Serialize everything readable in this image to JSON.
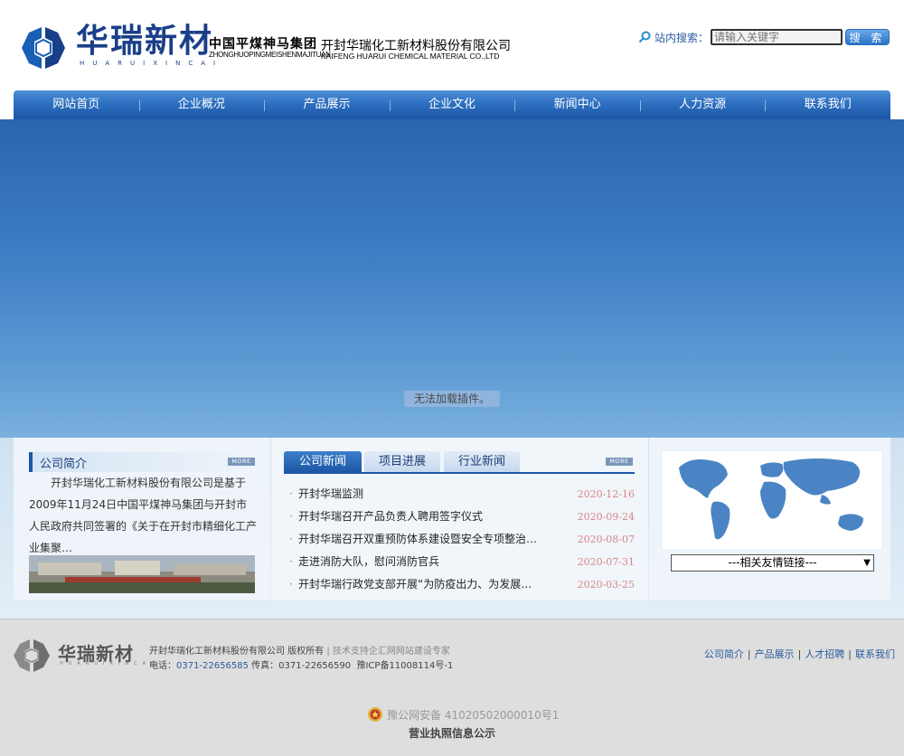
{
  "header": {
    "brand_cn": "华瑞新材",
    "brand_pinyin": "HUARUIXINCAI",
    "group_cn": "中国平煤神马集团",
    "group_pinyin": "ZHONGHUOPINGMEISHENMAJITUAN",
    "company_cn": "开封华瑞化工新材料股份有限公司",
    "company_en": "KAIFENG HUARUI CHEMICAL MATERIAL CO.,LTD"
  },
  "search": {
    "label": "站内搜索：",
    "placeholder": "请输入关键字",
    "button": "搜 索"
  },
  "nav": {
    "items": [
      "网站首页",
      "企业概况",
      "产品展示",
      "企业文化",
      "新闻中心",
      "人力资源",
      "联系我们"
    ]
  },
  "banner": {
    "plugin_message": "无法加载插件。"
  },
  "about": {
    "title": "公司简介",
    "more": "MORE",
    "text": "开封华瑞化工新材料股份有限公司是基于2009年11月24日中国平煤神马集团与开封市人民政府共同签署的《关于在开封市精细化工产业集聚…"
  },
  "news": {
    "tabs": [
      "公司新闻",
      "项目进展",
      "行业新闻"
    ],
    "more": "MORE",
    "items": [
      {
        "title": "开封华瑞监测",
        "date": "2020-12-16"
      },
      {
        "title": "开封华瑞召开产品负责人聘用签字仪式",
        "date": "2020-09-24"
      },
      {
        "title": "开封华瑞召开双重预防体系建设暨安全专项整治…",
        "date": "2020-08-07"
      },
      {
        "title": "走进消防大队，慰问消防官兵",
        "date": "2020-07-31"
      },
      {
        "title": "开封华瑞行政党支部开展“为防疫出力、为发展…",
        "date": "2020-03-25"
      }
    ]
  },
  "links": {
    "select_value": "---相关友情链接---"
  },
  "footer": {
    "brand": "华瑞新材",
    "brand_pinyin": "HUARUIXINCAI",
    "copyright": "开封华瑞化工新材料股份有限公司 版权所有",
    "tech_support": "| 技术支持企汇网网站建设专家",
    "phone_label": "电话：",
    "phone": "0371-22656585",
    "fax_label": " 传真：",
    "fax": "0371-22656590",
    "icp": "豫ICP备11008114号-1",
    "links": [
      "公司简介",
      "产品展示",
      "人才招聘",
      "联系我们"
    ],
    "police_record": "豫公网安备 41020502000010号1",
    "license": "营业执照信息公示"
  },
  "colors": {
    "nav": "#2d6fc0",
    "brand": "#1a3f8a",
    "date": "#d98585"
  }
}
